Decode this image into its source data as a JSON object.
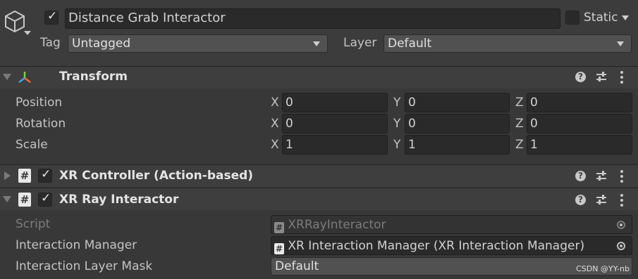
{
  "header": {
    "object_name": "Distance Grab Interactor",
    "static_label": "Static",
    "tag_label": "Tag",
    "tag_value": "Untagged",
    "layer_label": "Layer",
    "layer_value": "Default"
  },
  "transform": {
    "title": "Transform",
    "rows": [
      {
        "label": "Position",
        "x": "0",
        "y": "0",
        "z": "0"
      },
      {
        "label": "Rotation",
        "x": "0",
        "y": "0",
        "z": "0"
      },
      {
        "label": "Scale",
        "x": "1",
        "y": "1",
        "z": "1"
      }
    ],
    "axis": {
      "x": "X",
      "y": "Y",
      "z": "Z"
    }
  },
  "xr_controller": {
    "title": "XR Controller (Action-based)"
  },
  "xr_ray": {
    "title": "XR Ray Interactor",
    "script_label": "Script",
    "script_value": "XRRayInteractor",
    "manager_label": "Interaction Manager",
    "manager_value": "XR Interaction Manager (XR Interaction Manager)",
    "mask_label": "Interaction Layer Mask",
    "mask_value": "Default"
  },
  "icons": {
    "help": "?",
    "hash": "#",
    "check": "✓"
  },
  "watermark": "CSDN @YY-nb"
}
